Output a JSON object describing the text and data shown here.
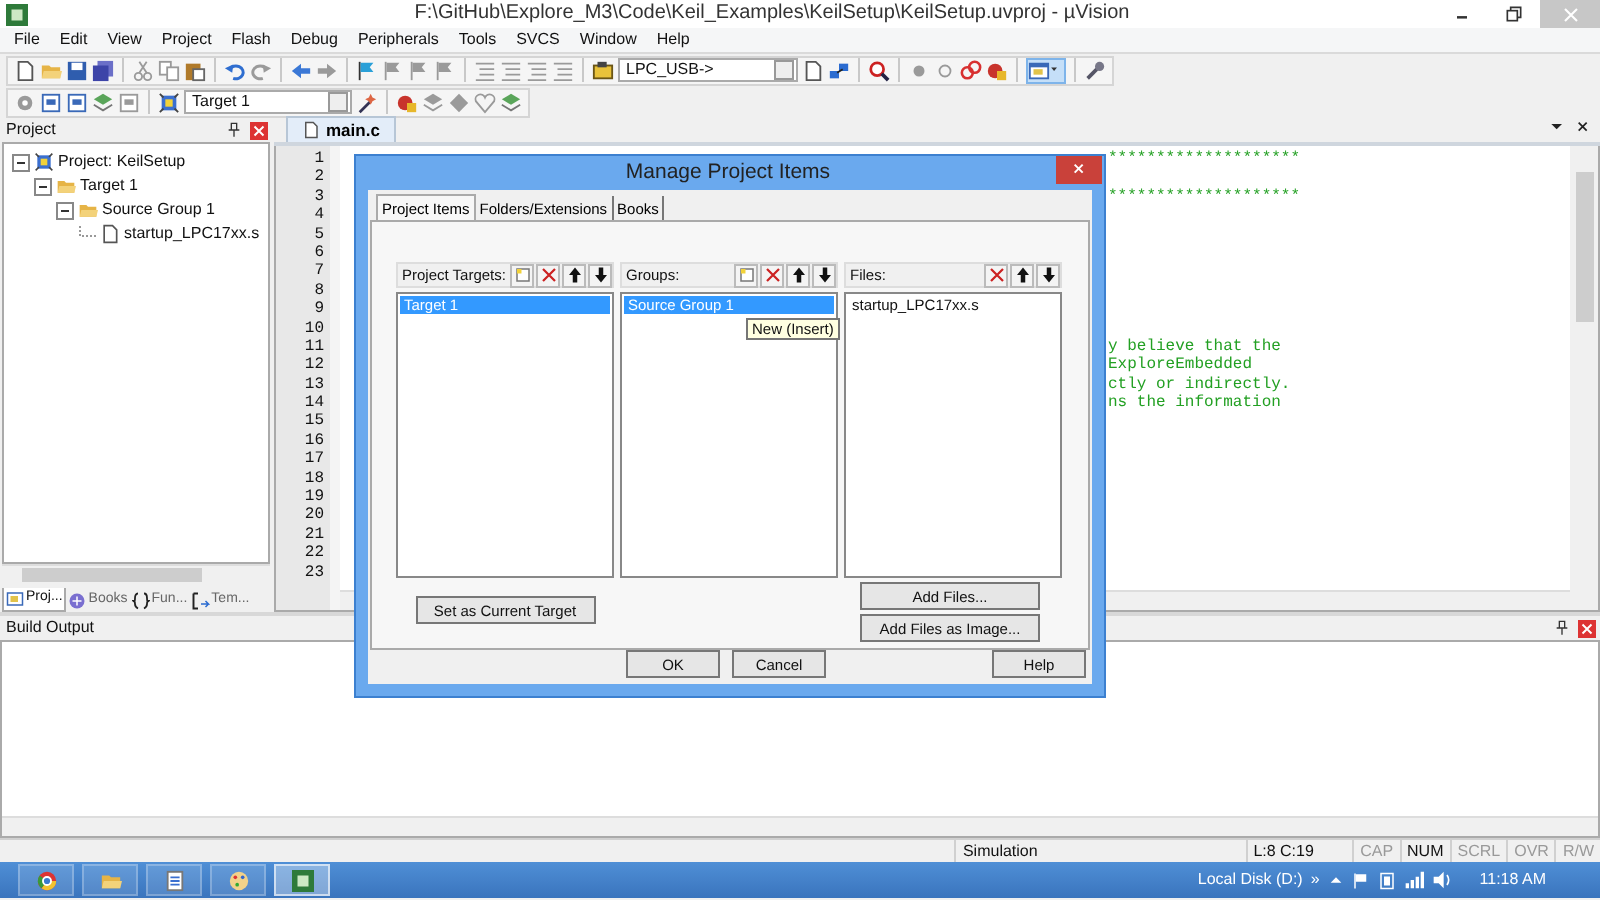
{
  "window": {
    "title": "F:\\GitHub\\Explore_M3\\Code\\Keil_Examples\\KeilSetup\\KeilSetup.uvproj - µVision"
  },
  "menu": [
    "File",
    "Edit",
    "View",
    "Project",
    "Flash",
    "Debug",
    "Peripherals",
    "Tools",
    "SVCS",
    "Window",
    "Help"
  ],
  "toolbar": {
    "debug_adapter": "LPC_USB->",
    "target": "Target 1"
  },
  "project_panel": {
    "title": "Project",
    "tree": [
      {
        "label": "Project: KeilSetup",
        "kind": "project",
        "expanded": true,
        "children": [
          {
            "label": "Target 1",
            "kind": "target",
            "expanded": true,
            "children": [
              {
                "label": "Source Group 1",
                "kind": "group",
                "expanded": true,
                "children": [
                  {
                    "label": "startup_LPC17xx.s",
                    "kind": "file"
                  }
                ]
              }
            ]
          }
        ]
      }
    ],
    "tabs": [
      {
        "label": "Proj...",
        "kind": "project",
        "selected": true
      },
      {
        "label": "Books",
        "kind": "books",
        "selected": false
      },
      {
        "label": "Fun...",
        "kind": "functions",
        "selected": false
      },
      {
        "label": "Tem...",
        "kind": "templates",
        "selected": false
      }
    ]
  },
  "editor": {
    "tabs": [
      {
        "label": "main.c",
        "selected": true
      }
    ],
    "lines": [
      {
        "number": "1",
        "text": "********************"
      },
      {
        "number": "2"
      },
      {
        "number": "3",
        "text": "********************"
      },
      {
        "number": "4"
      },
      {
        "number": "5"
      },
      {
        "number": "6"
      },
      {
        "number": "7"
      },
      {
        "number": "8"
      },
      {
        "number": "9"
      },
      {
        "number": "10"
      },
      {
        "number": "11",
        "text": "y believe that the"
      },
      {
        "number": "12",
        "text": "ExploreEmbedded"
      },
      {
        "number": "13",
        "text": "ctly or indirectly."
      },
      {
        "number": "14",
        "text": "ns the information"
      },
      {
        "number": "15"
      },
      {
        "number": "16"
      },
      {
        "number": "17"
      },
      {
        "number": "18"
      },
      {
        "number": "19"
      },
      {
        "number": "20"
      },
      {
        "number": "21"
      },
      {
        "number": "22"
      },
      {
        "number": "23"
      }
    ]
  },
  "dialog": {
    "title": "Manage Project Items",
    "tabs": [
      {
        "label": "Project Items",
        "selected": true
      },
      {
        "label": "Folders/Extensions",
        "selected": false
      },
      {
        "label": "Books",
        "selected": false
      }
    ],
    "columns": [
      {
        "heading": "Project Targets:",
        "tool_kinds": [
          {
            "kind": "new"
          },
          {
            "kind": "delete"
          },
          {
            "kind": "up"
          },
          {
            "kind": "down"
          }
        ],
        "items": [
          {
            "label": "Target 1",
            "selected": true
          }
        ]
      },
      {
        "heading": "Groups:",
        "tool_kinds": [
          {
            "kind": "new"
          },
          {
            "kind": "delete"
          },
          {
            "kind": "up"
          },
          {
            "kind": "down"
          }
        ],
        "items": [
          {
            "label": "Source Group 1",
            "selected": true
          }
        ]
      },
      {
        "heading": "Files:",
        "tool_kinds": [
          {
            "kind": "delete"
          },
          {
            "kind": "up"
          },
          {
            "kind": "down"
          }
        ],
        "items": [
          {
            "label": "startup_LPC17xx.s",
            "selected": false
          }
        ]
      }
    ],
    "tooltip": "New (Insert)",
    "target_button": "Set as Current Target",
    "file_buttons": [
      "Add Files...",
      "Add Files as Image..."
    ],
    "buttons": [
      "OK",
      "Cancel",
      "Help"
    ]
  },
  "build_output": {
    "title": "Build Output"
  },
  "status_bar": {
    "mode": "Simulation",
    "position": "L:8 C:19",
    "indicators": [
      {
        "label": "CAP",
        "on": false
      },
      {
        "label": "NUM",
        "on": true
      },
      {
        "label": "SCRL",
        "on": false
      },
      {
        "label": "OVR",
        "on": false
      },
      {
        "label": "R/W",
        "on": false
      }
    ]
  },
  "taskbar": {
    "apps": [
      {
        "kind": "browser",
        "selected": false
      },
      {
        "kind": "folder",
        "selected": false
      },
      {
        "kind": "notepad",
        "selected": false
      },
      {
        "kind": "paint",
        "selected": false
      },
      {
        "kind": "keil",
        "selected": true
      }
    ],
    "drive": "Local Disk (D:)",
    "overflow": "»",
    "clock": "11:18 AM"
  }
}
